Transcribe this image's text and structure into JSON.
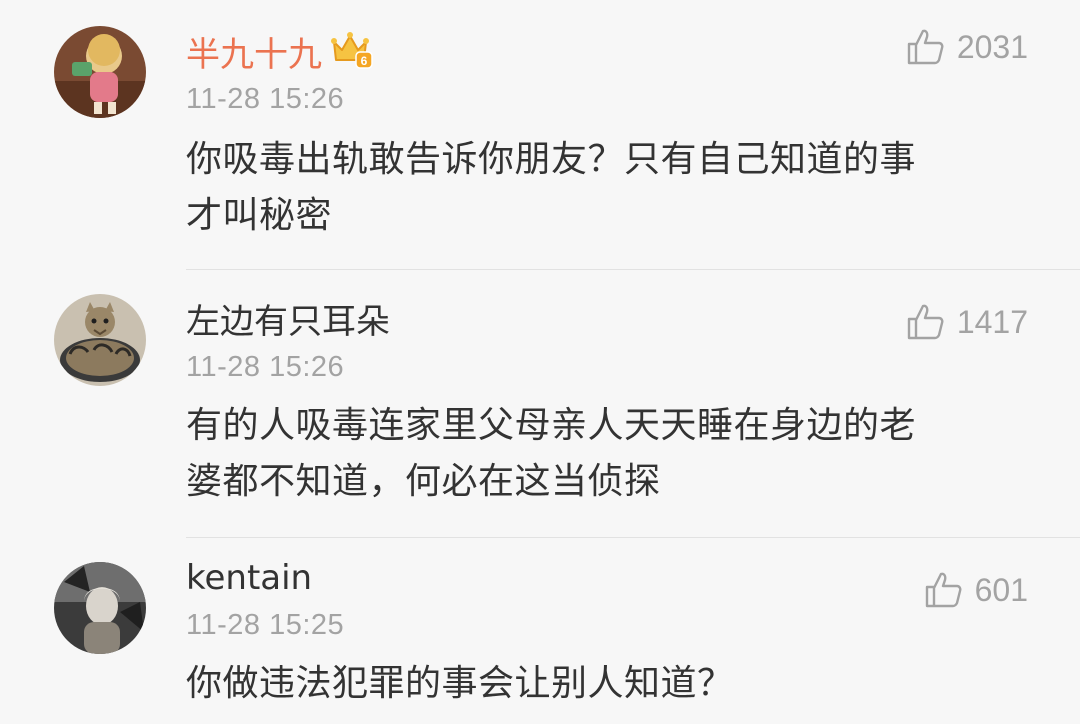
{
  "comments": [
    {
      "username": "半九十九",
      "time": "11-28 15:26",
      "likes": "2031",
      "text_lines": [
        "你吸毒出轨敢告诉你朋友？只有自己知道的事",
        "才叫秘密"
      ],
      "vip": true,
      "vip_badge_text": "6"
    },
    {
      "username": "左边有只耳朵",
      "time": "11-28 15:26",
      "likes": "1417",
      "text_lines": [
        "有的人吸毒连家里父母亲人天天睡在身边的老",
        "婆都不知道，何必在这当侦探"
      ]
    },
    {
      "username": "kentain",
      "time": "11-28 15:25",
      "likes": "601",
      "text_lines": [
        "你做违法犯罪的事会让别人知道？"
      ]
    }
  ],
  "colors": {
    "background": "#f7f7f7",
    "vip_name": "#eb7350",
    "text": "#333333",
    "meta": "#a3a3a3",
    "divider": "#e2e2e2"
  },
  "icons": {
    "like": "thumbs-up-icon",
    "vip": "crown-badge-icon"
  }
}
